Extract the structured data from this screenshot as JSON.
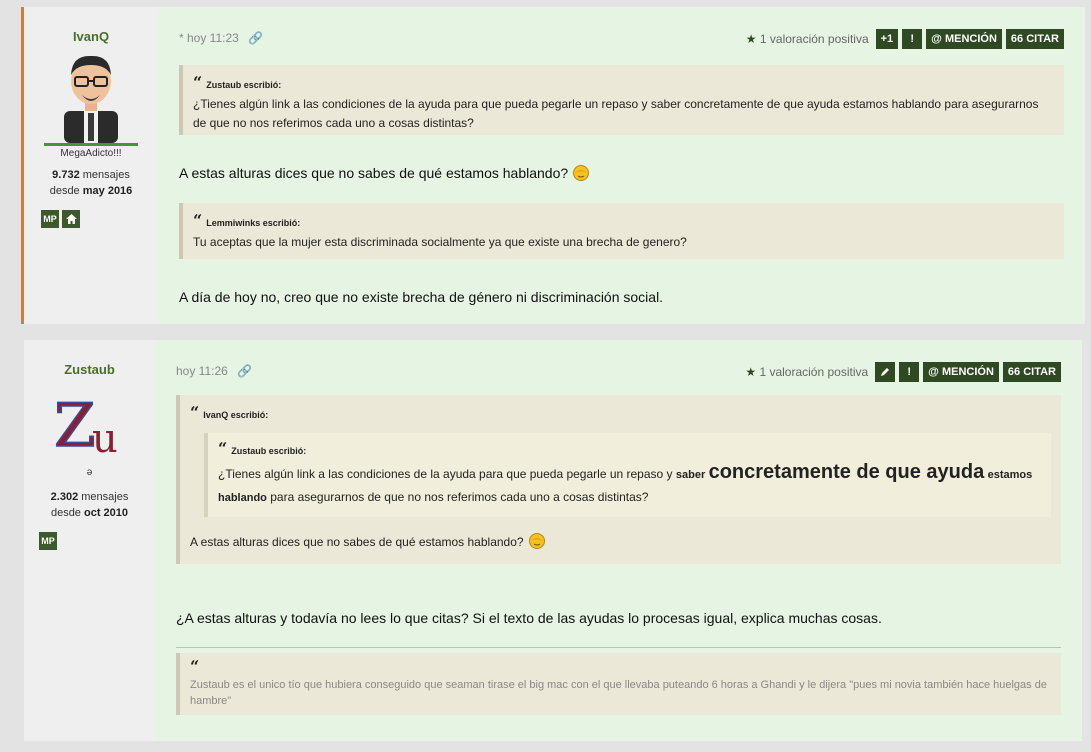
{
  "posts": [
    {
      "author": "IvanQ",
      "rank": "MegaAdicto!!!",
      "messages_count": "9.732",
      "messages_label": "mensajes",
      "since_label": "desde",
      "since": "may 2016",
      "side_buttons": [
        "MP",
        "home-icon"
      ],
      "time": "* hoy 11:23",
      "votes": "1 valoración positiva",
      "actions": [
        "+1",
        "!",
        "@ MENCIÓN",
        "66 CITAR"
      ],
      "quote1": {
        "author": "Zustaub escribió:",
        "text": "¿Tienes algún link a las condiciones de la ayuda para que pueda pegarle un repaso y saber concretamente de que ayuda estamos hablando para asegurarnos de que no nos referimos cada uno a cosas distintas?"
      },
      "reply1": "A estas alturas dices que no sabes de qué estamos hablando?",
      "quote2": {
        "author": "Lemmiwinks escribió:",
        "text": "Tu aceptas que la mujer esta discriminada socialmente ya que existe una brecha de genero?"
      },
      "reply2": "A día de hoy no, creo que no existe brecha de género ni discriminación social."
    },
    {
      "author": "Zustaub",
      "avatar_text": "Zu",
      "rank": "ə",
      "messages_count": "2.302",
      "messages_label": "mensajes",
      "since_label": "desde",
      "since": "oct 2010",
      "side_buttons": [
        "MP"
      ],
      "time": "hoy 11:26",
      "votes": "1 valoración positiva",
      "actions": [
        "pencil-icon",
        "!",
        "@ MENCIÓN",
        "66 CITAR"
      ],
      "outer_quote": {
        "author": "IvanQ escribió:",
        "inner_author": "Zustaub escribió:",
        "inner_text_a": "¿Tienes algún link a las condiciones de la ayuda para que pueda pegarle un repaso y",
        "inner_bold_small": "saber",
        "inner_big": "concretamente de que ayuda",
        "inner_bold2": "estamos hablando",
        "inner_text_b": "para asegurarnos de que no nos referimos cada uno a cosas distintas?",
        "text": "A estas alturas dices que no sabes de qué estamos hablando?"
      },
      "reply": "¿A estas alturas y todavía no lees lo que citas? Si el texto de las ayudas lo procesas igual, explica muchas cosas.",
      "signature": "Zustaub es el unico tío que hubiera conseguido que seaman tirase el big mac con el que llevaba puteando 6 horas a Ghandi y le dijera \"pues mi novia también hace huelgas de hambre\""
    }
  ]
}
